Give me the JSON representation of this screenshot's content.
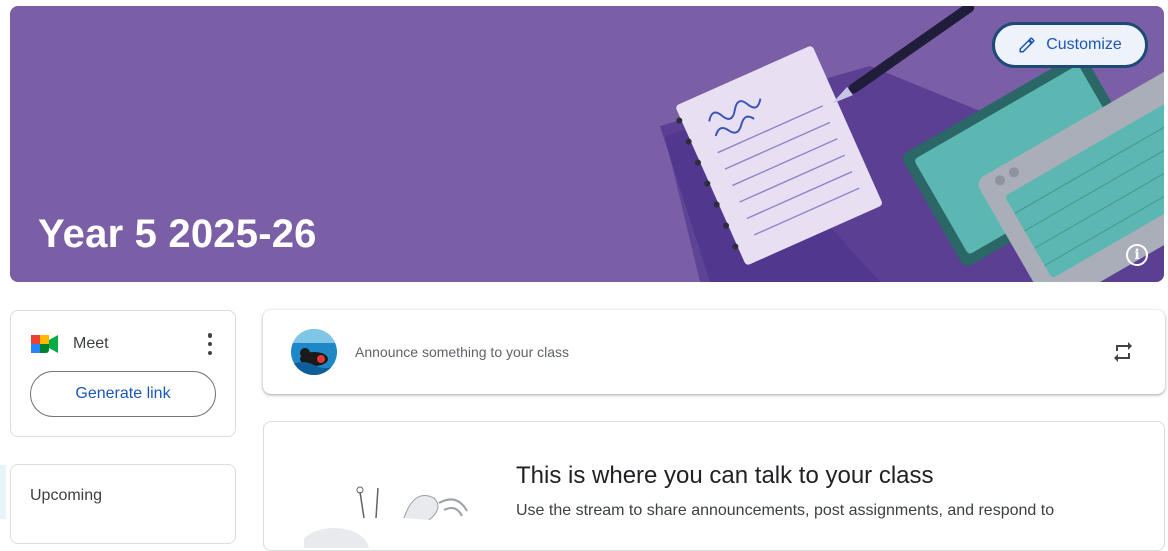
{
  "banner": {
    "class_title": "Year 5 2025-26",
    "customize_label": "Customize",
    "info_glyph": "i",
    "background_color": "#7a5ea6"
  },
  "meet": {
    "label": "Meet",
    "generate_link_label": "Generate link",
    "icon": "google-meet-icon"
  },
  "upcoming": {
    "title": "Upcoming"
  },
  "announce": {
    "placeholder": "Announce something to your class",
    "icon": "repost-icon"
  },
  "stream": {
    "heading": "This is where you can talk to your class",
    "body": "Use the stream to share announcements, post assignments, and respond to"
  },
  "colors": {
    "accent_blue": "#1a57b8",
    "border": "#dadce0"
  }
}
